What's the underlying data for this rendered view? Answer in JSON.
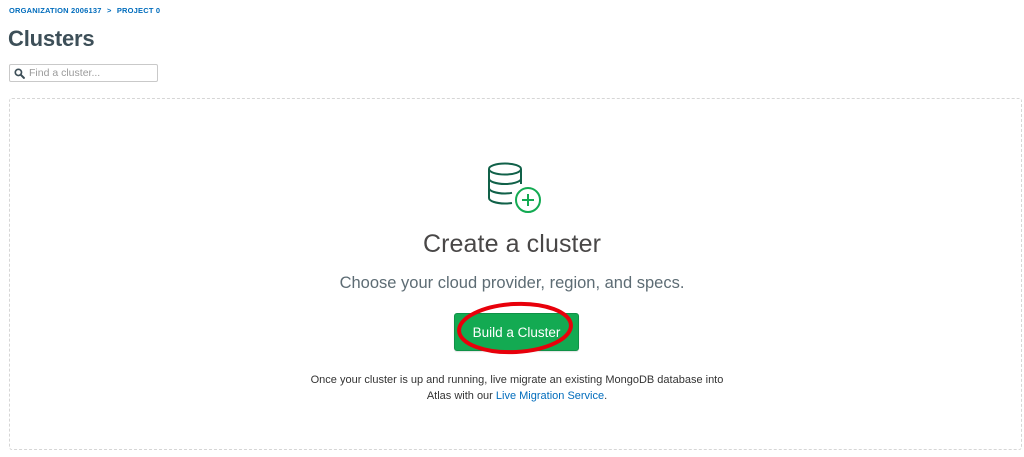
{
  "breadcrumb": {
    "organization": "ORGANIZATION 2006137",
    "separator": ">",
    "project": "PROJECT 0"
  },
  "page": {
    "title": "Clusters"
  },
  "search": {
    "placeholder": "Find a cluster...",
    "value": "",
    "icon": "search-icon"
  },
  "empty_state": {
    "icon": "database-add-icon",
    "title": "Create a cluster",
    "subtitle": "Choose your cloud provider, region, and specs.",
    "build_button_label": "Build a Cluster",
    "migration_text_line1": "Once your cluster is up and running, live migrate an existing MongoDB database into",
    "migration_text_line2_prefix": "Atlas with our ",
    "migration_link_label": "Live Migration Service",
    "migration_text_suffix": "."
  },
  "colors": {
    "breadcrumb": "#006cbc",
    "primary_button": "#13aa52",
    "icon_stroke": "#116149",
    "icon_plus": "#13aa52",
    "highlight_ring": "#e8000b"
  }
}
